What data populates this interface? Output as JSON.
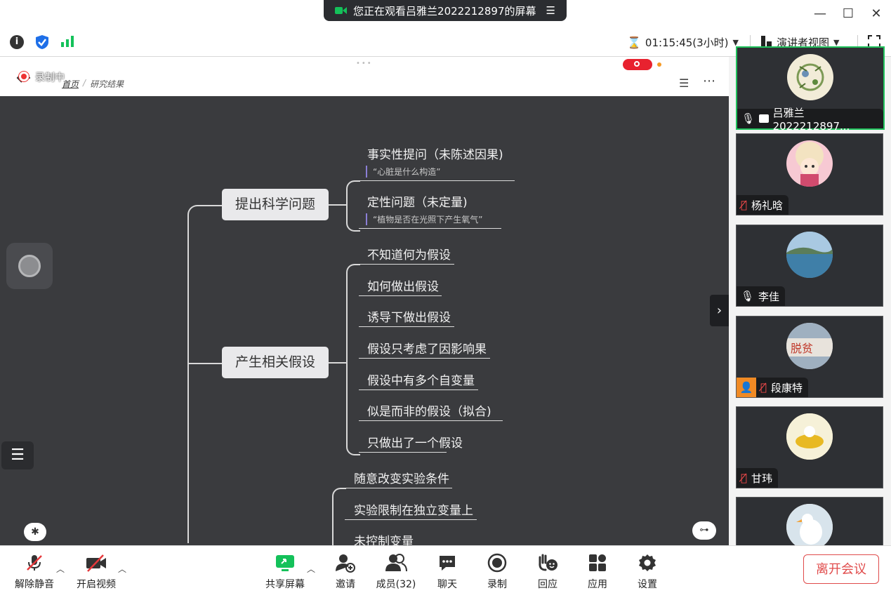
{
  "banner": {
    "text": "您正在观看吕雅兰2022212897的屏幕"
  },
  "toolbar": {
    "timer": "01:15:45(3小时)",
    "view_mode": "演讲者视图"
  },
  "doc": {
    "recording_badge": "录制中",
    "breadcrumb_home": "首页",
    "breadcrumb_sep": "/",
    "breadcrumb_current": "研究结果"
  },
  "mindmap": {
    "groups": [
      {
        "title": "提出科学问题"
      },
      {
        "title": "产生相关假设"
      }
    ],
    "g1_leaves": [
      {
        "text": "事实性提问（未陈述因果)",
        "quote": "“心脏是什么构造”"
      },
      {
        "text": "定性问题（未定量)",
        "quote": "“植物是否在光照下产生氧气”"
      }
    ],
    "g2_leaves": [
      "不知道何为假设",
      "如何做出假设",
      "诱导下做出假设",
      "假设只考虑了因影响果",
      "假设中有多个自变量",
      "似是而非的假设（拟合)",
      "只做出了一个假设"
    ],
    "g3_leaves": [
      "随意改变实验条件",
      "实验限制在独立变量上",
      "未控制变量"
    ]
  },
  "participants": [
    {
      "name": "吕雅兰2022212897...",
      "mic": "on",
      "sharing": true,
      "active": true,
      "avatar_color": "#f2ecd8"
    },
    {
      "name": "杨礼晗",
      "mic": "muted",
      "avatar_color": "#f7c9d3"
    },
    {
      "name": "李佳",
      "mic": "on",
      "avatar_color": "#6aa3c9"
    },
    {
      "name": "段康特",
      "mic": "muted",
      "host_badge": true,
      "avatar_color": "#c9c3c0"
    },
    {
      "name": "甘玮",
      "mic": "muted",
      "avatar_color": "#f3e6b3"
    },
    {
      "name": "",
      "mic": "none",
      "avatar_color": "#e6d7c8"
    }
  ],
  "bottom_left": [
    {
      "label": "解除静音",
      "icon": "mic-muted-icon"
    },
    {
      "label": "开启视频",
      "icon": "video-off-icon"
    }
  ],
  "bottom_center": [
    {
      "label": "共享屏幕",
      "icon": "share-screen-icon"
    },
    {
      "label": "邀请",
      "icon": "invite-icon"
    },
    {
      "label": "成员(32)",
      "icon": "members-icon"
    },
    {
      "label": "聊天",
      "icon": "chat-icon"
    },
    {
      "label": "录制",
      "icon": "record-icon"
    },
    {
      "label": "回应",
      "icon": "reaction-icon"
    },
    {
      "label": "应用",
      "icon": "apps-icon"
    },
    {
      "label": "设置",
      "icon": "settings-icon"
    }
  ],
  "leave_button": {
    "label": "离开会议"
  },
  "colors": {
    "accent_green": "#14c15a",
    "leave_red": "#e04b4b",
    "node_bg": "#e9e9eb",
    "canvas_bg": "#3a3b3e"
  }
}
